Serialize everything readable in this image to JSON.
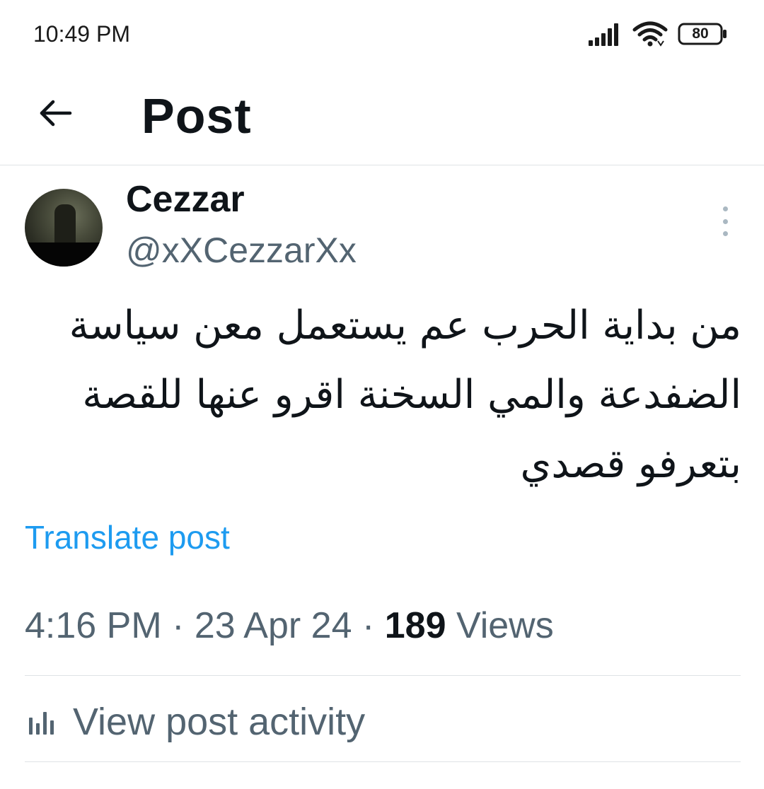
{
  "status_bar": {
    "time": "10:49 PM",
    "battery": "80"
  },
  "header": {
    "title": "Post",
    "back_icon": "arrow-left-icon"
  },
  "post": {
    "author": {
      "display_name": "Cezzar",
      "handle": "@xXCezzarXx"
    },
    "text_lines": [
      "من بداية الحرب عم يستعمل معن سياسة",
      "الضفدعة والمي السخنة اقرو عنها للقصة",
      "بتعرفو قصدي"
    ],
    "translate_label": "Translate post",
    "time": "4:16 PM",
    "date": "23 Apr 24",
    "views_count": "189",
    "views_label": "Views",
    "separator": "·"
  },
  "activity": {
    "label": "View post activity",
    "icon": "bar-chart-icon"
  },
  "colors": {
    "accent": "#1d9bf0",
    "secondary_text": "#536471",
    "primary_text": "#0f1419",
    "divider": "#dfe3e6"
  }
}
